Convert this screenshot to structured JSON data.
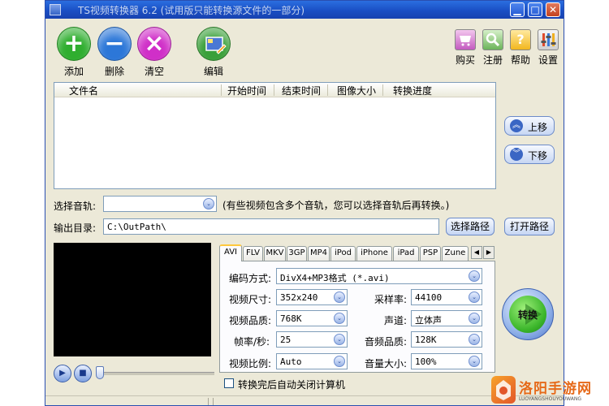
{
  "window": {
    "title": "TS视频转换器 6.2 (试用版只能转换源文件的一部分)",
    "min_glyph": "▁",
    "max_glyph": "□",
    "close_glyph": "✕"
  },
  "toolbar": {
    "add_label": "添加",
    "delete_label": "删除",
    "clear_label": "清空",
    "edit_label": "编辑",
    "buy_label": "购买",
    "register_label": "注册",
    "help_label": "帮助",
    "settings_label": "设置",
    "add_glyph": "+",
    "delete_glyph": "−",
    "clear_glyph": "×",
    "help_glyph": "?"
  },
  "file_list": {
    "columns": [
      "文件名",
      "开始时间",
      "结束时间",
      "图像大小",
      "转换进度"
    ],
    "rows": []
  },
  "move_buttons": {
    "up_label": "上移",
    "down_label": "下移"
  },
  "audio_track": {
    "label": "选择音轨:",
    "value": "",
    "hint": "(有些视频包含多个音轨，您可以选择音轨后再转换。)"
  },
  "output": {
    "label": "输出目录:",
    "path": "C:\\OutPath\\",
    "select_button": "选择路径",
    "open_button": "打开路径"
  },
  "format_tabs": [
    "AVI",
    "FLV",
    "MKV",
    "3GP",
    "MP4",
    "iPod",
    "iPhone",
    "iPad",
    "PSP",
    "Zune"
  ],
  "active_tab": "AVI",
  "settings": {
    "codec_label": "编码方式:",
    "codec_value": "DivX4+MP3格式 (*.avi)",
    "size_label": "视频尺寸:",
    "size_value": "352x240",
    "quality_label": "视频品质:",
    "quality_value": "768K",
    "fps_label": "帧率/秒:",
    "fps_value": "25",
    "ratio_label": "视频比例:",
    "ratio_value": "Auto",
    "samplerate_label": "采样率:",
    "samplerate_value": "44100",
    "channel_label": "声道:",
    "channel_value": "立体声",
    "audio_quality_label": "音频品质:",
    "audio_quality_value": "128K",
    "volume_label": "音量大小:",
    "volume_value": "100%"
  },
  "convert": {
    "label": "转换"
  },
  "shutdown": {
    "label": "转换完后自动关闭计算机",
    "checked": false
  },
  "watermark": {
    "text": "洛阳手游网",
    "sub": "LUOYANGSHOUYOUWANG"
  },
  "colors": {
    "add": "#2fae2f",
    "delete": "#2c77d8",
    "clear": "#d02fc8",
    "titlebar": "#1a4fc4",
    "tab_highlight": "#ffc83c"
  }
}
